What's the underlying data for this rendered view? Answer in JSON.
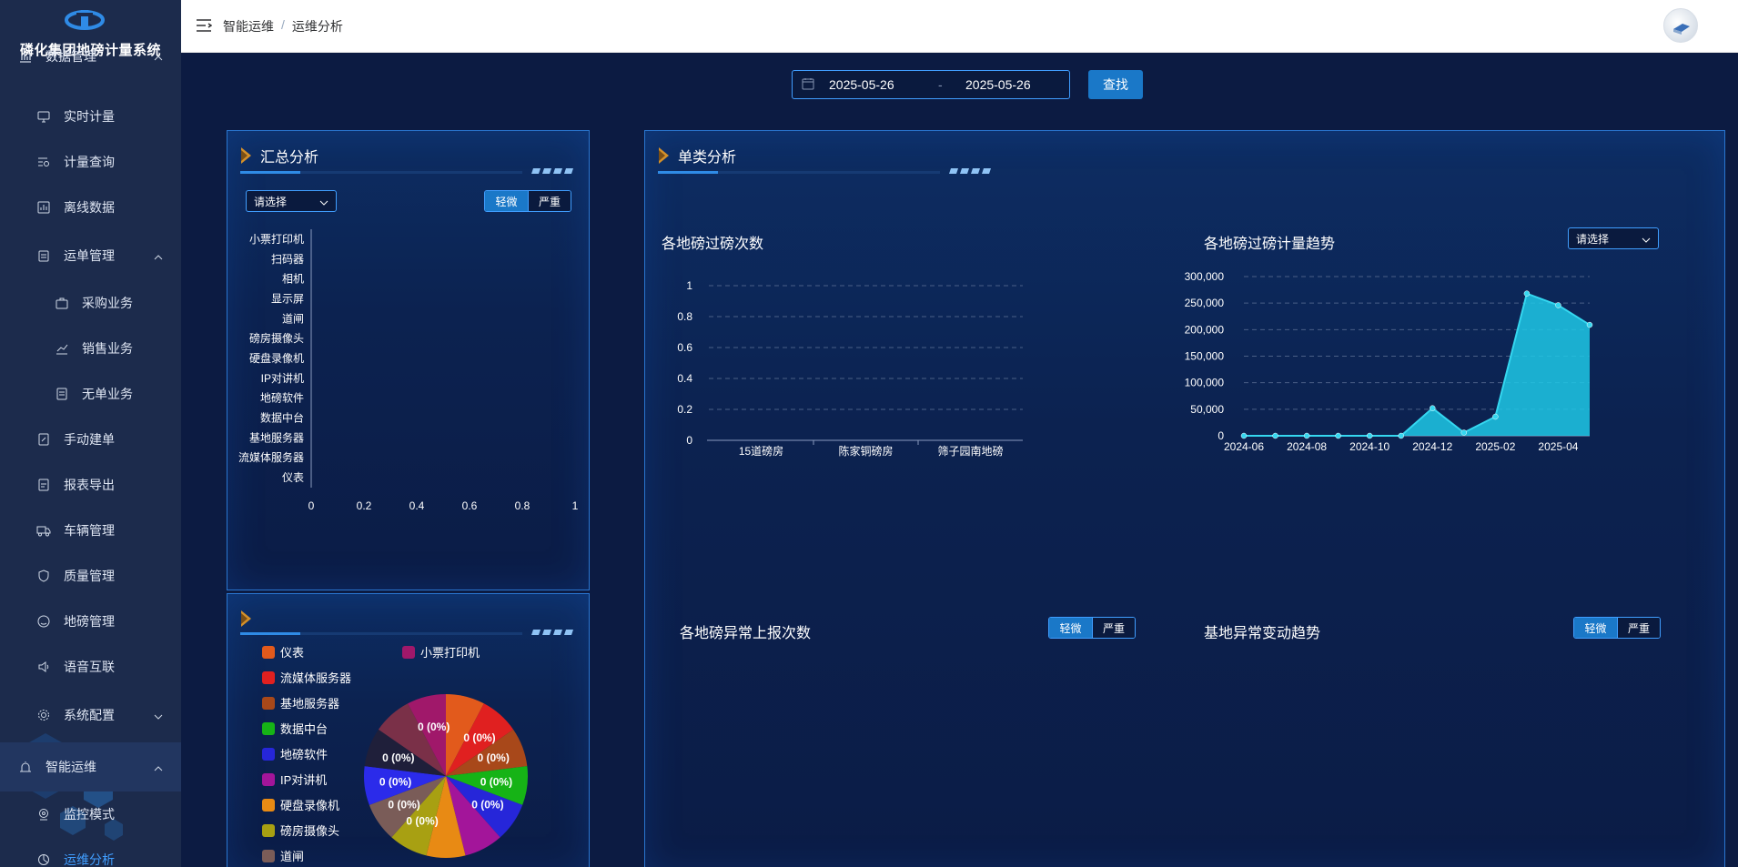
{
  "app": {
    "title": "磷化集团地磅计量系统"
  },
  "sidebar": {
    "items": [
      {
        "label": "数据管理",
        "icon": "bar-chart-icon"
      },
      {
        "label": "实时计量",
        "icon": "monitor-icon"
      },
      {
        "label": "计量查询",
        "icon": "search-doc-icon"
      },
      {
        "label": "离线数据",
        "icon": "chart-doc-icon"
      },
      {
        "label": "运单管理",
        "icon": "clipboard-icon"
      },
      {
        "label": "采购业务",
        "icon": "bag-icon"
      },
      {
        "label": "销售业务",
        "icon": "trend-icon"
      },
      {
        "label": "无单业务",
        "icon": "document-icon"
      },
      {
        "label": "手动建单",
        "icon": "edit-doc-icon"
      },
      {
        "label": "报表导出",
        "icon": "report-icon"
      },
      {
        "label": "车辆管理",
        "icon": "truck-icon"
      },
      {
        "label": "质量管理",
        "icon": "shield-icon"
      },
      {
        "label": "地磅管理",
        "icon": "scale-icon"
      },
      {
        "label": "语音互联",
        "icon": "speaker-icon"
      },
      {
        "label": "系统配置",
        "icon": "gear-icon"
      },
      {
        "label": "智能运维",
        "icon": "alarm-icon"
      },
      {
        "label": "监控模式",
        "icon": "camera-icon"
      },
      {
        "label": "运维分析",
        "icon": "pie-icon"
      }
    ]
  },
  "header": {
    "breadcrumb": [
      "智能运维",
      "运维分析"
    ],
    "separator": "/"
  },
  "filters": {
    "date_start": "2025-05-26",
    "date_end": "2025-05-26",
    "date_separator": "-",
    "search_label": "查找"
  },
  "summary_panel": {
    "title": "汇总分析",
    "select_placeholder": "请选择",
    "toggle": [
      "轻微",
      "严重"
    ]
  },
  "single_panel": {
    "title": "单类分析",
    "chart1_title": "各地磅过磅次数",
    "chart2_title": "各地磅过磅计量趋势",
    "chart2_select": "请选择",
    "chart3_title": "各地磅异常上报次数",
    "chart4_title": "基地异常变动趋势",
    "toggle": [
      "轻微",
      "严重"
    ]
  },
  "chart_data": [
    {
      "type": "bar",
      "orientation": "horizontal",
      "categories": [
        "小票打印机",
        "扫码器",
        "相机",
        "显示屏",
        "道闸",
        "磅房摄像头",
        "硬盘录像机",
        "IP对讲机",
        "地磅软件",
        "数据中台",
        "基地服务器",
        "流媒体服务器",
        "仪表"
      ],
      "values": [
        0,
        0,
        0,
        0,
        0,
        0,
        0,
        0,
        0,
        0,
        0,
        0,
        0
      ],
      "xlim": [
        0,
        1
      ],
      "xticks": [
        "0",
        "0.2",
        "0.4",
        "0.6",
        "0.8",
        "1"
      ]
    },
    {
      "type": "pie",
      "legend": [
        {
          "name": "仪表",
          "color": "#e25a1c"
        },
        {
          "name": "小票打印机",
          "color": "#a0186a"
        },
        {
          "name": "流媒体服务器",
          "color": "#e02020"
        },
        {
          "name": "基地服务器",
          "color": "#a8481a"
        },
        {
          "name": "数据中台",
          "color": "#16b316"
        },
        {
          "name": "地磅软件",
          "color": "#2626d9"
        },
        {
          "name": "IP对讲机",
          "color": "#a3159a"
        },
        {
          "name": "硬盘录像机",
          "color": "#e88a14"
        },
        {
          "name": "磅房摄像头",
          "color": "#a8a012"
        },
        {
          "name": "道闸",
          "color": "#7a5c58"
        }
      ],
      "slices": [
        {
          "color": "#e25a1c",
          "label": ""
        },
        {
          "color": "#e02020",
          "label": "0 (0%)"
        },
        {
          "color": "#a8481a",
          "label": "0 (0%)"
        },
        {
          "color": "#16b316",
          "label": "0 (0%)"
        },
        {
          "color": "#2626d9",
          "label": "0 (0%)"
        },
        {
          "color": "#a3159a",
          "label": ""
        },
        {
          "color": "#e88a14",
          "label": ""
        },
        {
          "color": "#a8a012",
          "label": "0 (0%)"
        },
        {
          "color": "#7a5c58",
          "label": "0 (0%)"
        },
        {
          "color": "#2b2bea",
          "label": "0 (0%)"
        },
        {
          "color": "#1f1f3a",
          "label": "0 (0%)"
        },
        {
          "color": "#7a3048",
          "label": ""
        },
        {
          "color": "#a0186a",
          "label": "0 (0%)"
        }
      ]
    },
    {
      "type": "bar",
      "categories": [
        "15道磅房",
        "陈家铜磅房",
        "筛子园南地磅"
      ],
      "values": [
        0,
        0,
        0
      ],
      "ylim": [
        0,
        1
      ],
      "yticks": [
        "0",
        "0.2",
        "0.4",
        "0.6",
        "0.8",
        "1"
      ]
    },
    {
      "type": "area",
      "x": [
        "2024-06",
        "2024-07",
        "2024-08",
        "2024-09",
        "2024-10",
        "2024-11",
        "2024-12",
        "2025-01",
        "2025-02",
        "2025-03",
        "2025-04",
        "2025-05"
      ],
      "values": [
        0,
        0,
        0,
        0,
        0,
        0,
        52000,
        6000,
        36000,
        268000,
        246000,
        209000
      ],
      "xticks": [
        "2024-06",
        "2024-08",
        "2024-10",
        "2024-12",
        "2025-02",
        "2025-04"
      ],
      "ylim": [
        0,
        300000
      ],
      "yticks": [
        "0",
        "50,000",
        "100,000",
        "150,000",
        "200,000",
        "250,000",
        "300,000"
      ],
      "color": "#1ec8e6"
    }
  ],
  "colors": {
    "accent": "#409eff",
    "button": "#1a78c8",
    "background": "#0c1b42",
    "sidebar": "#1c2b4c"
  }
}
